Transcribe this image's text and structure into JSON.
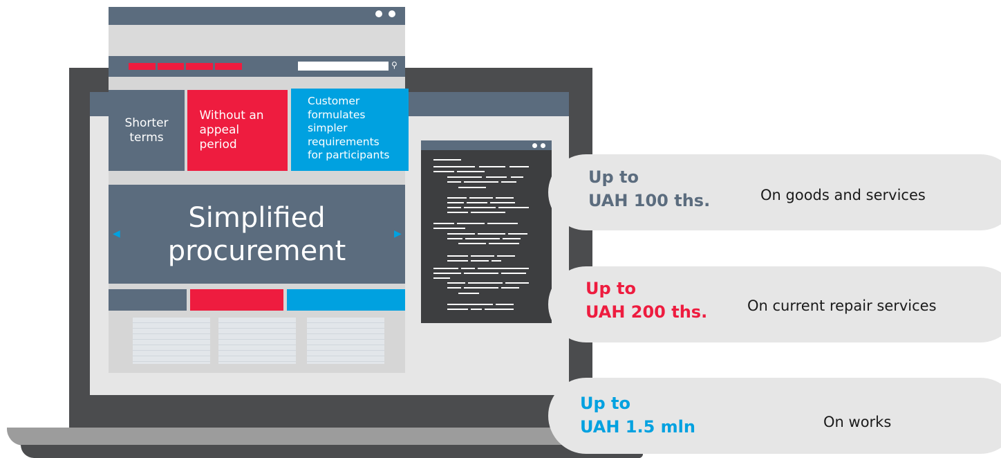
{
  "tiles": {
    "shorter": "Shorter\nterms",
    "no_appeal": "Without an\nappeal\nperiod",
    "customer": "Customer\nformulates\nsimpler\nrequirements\nfor participants"
  },
  "hero": {
    "title": "Simplified\nprocurement",
    "arrow_left": "◀",
    "arrow_right": "▶"
  },
  "search_icon": "⚲",
  "tiers": [
    {
      "amount": "Up to\nUAH 100 ths.",
      "description": "On goods and services",
      "color": "#5b6c7e"
    },
    {
      "amount": "Up to\nUAH 200 ths.",
      "description": "On current repair services",
      "color": "#ee1c3f"
    },
    {
      "amount": "Up to\nUAH 1.5 mln",
      "description": "On works",
      "color": "#00a1e0"
    }
  ],
  "colors": {
    "slate": "#5b6c7e",
    "red": "#ee1c3f",
    "blue": "#00a1e0",
    "laptop": "#4b4c4e"
  }
}
